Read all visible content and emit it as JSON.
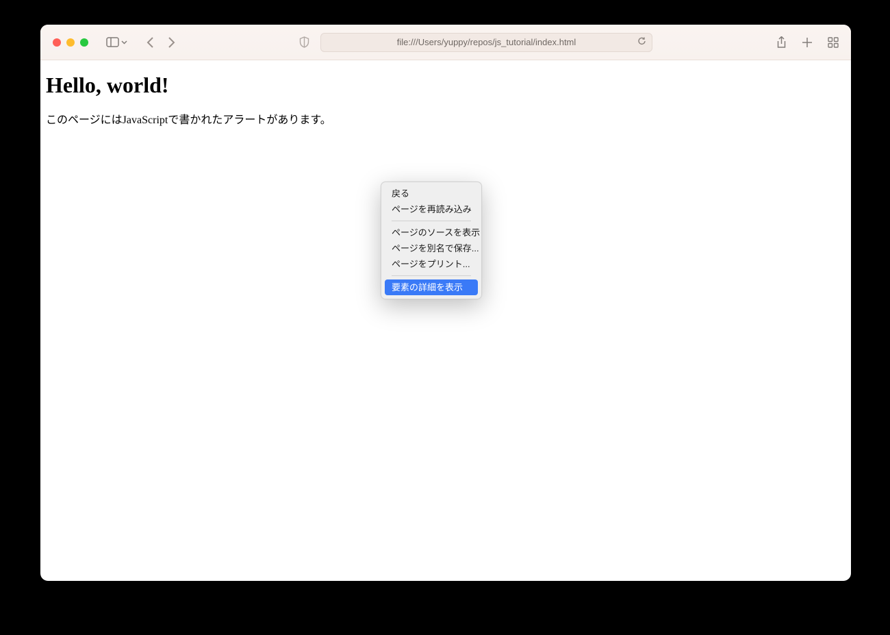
{
  "browser": {
    "url": "file:///Users/yuppy/repos/js_tutorial/index.html"
  },
  "page": {
    "heading": "Hello, world!",
    "paragraph": "このページにはJavaScriptで書かれたアラートがあります。"
  },
  "context_menu": {
    "items": [
      {
        "label": "戻る",
        "highlighted": false
      },
      {
        "label": "ページを再読み込み",
        "highlighted": false
      }
    ],
    "items2": [
      {
        "label": "ページのソースを表示",
        "highlighted": false
      },
      {
        "label": "ページを別名で保存...",
        "highlighted": false
      },
      {
        "label": "ページをプリント...",
        "highlighted": false
      }
    ],
    "items3": [
      {
        "label": "要素の詳細を表示",
        "highlighted": true
      }
    ]
  }
}
